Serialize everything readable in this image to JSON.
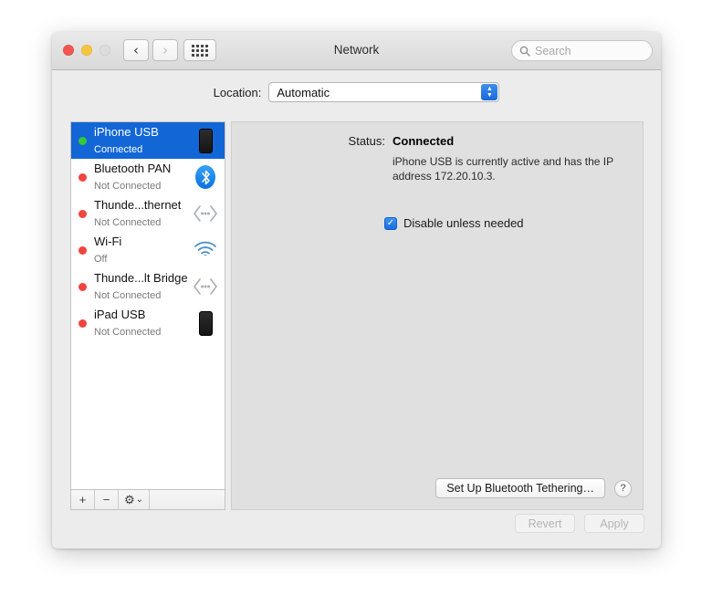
{
  "window": {
    "title": "Network",
    "traffic_lights": [
      "close",
      "minimize",
      "zoom-disabled"
    ],
    "nav_back_icon": "‹",
    "nav_forward_icon": "›",
    "grid_icon": "grid-view-icon"
  },
  "search": {
    "placeholder": "Search",
    "icon": "search-icon"
  },
  "location": {
    "label": "Location:",
    "value": "Automatic",
    "up_arrow": "▲",
    "down_arrow": "▼"
  },
  "sidebar": {
    "items": [
      {
        "name": "iPhone USB",
        "state": "Connected",
        "dot": "green",
        "icon": "iphone-icon",
        "selected": true
      },
      {
        "name": "Bluetooth PAN",
        "state": "Not Connected",
        "dot": "red",
        "icon": "bluetooth-icon",
        "selected": false
      },
      {
        "name": "Thunde...thernet",
        "state": "Not Connected",
        "dot": "red",
        "icon": "thunderbolt-icon",
        "selected": false
      },
      {
        "name": "Wi-Fi",
        "state": "Off",
        "dot": "red",
        "icon": "wifi-icon",
        "selected": false
      },
      {
        "name": "Thunde...lt Bridge",
        "state": "Not Connected",
        "dot": "red",
        "icon": "thunderbolt-icon",
        "selected": false
      },
      {
        "name": "iPad USB",
        "state": "Not Connected",
        "dot": "red",
        "icon": "ipad-icon",
        "selected": false
      }
    ],
    "toolbar": {
      "add_label": "+",
      "remove_label": "−",
      "gear_label": "⚙",
      "gear_chevron": "⌄"
    }
  },
  "main": {
    "status_label": "Status:",
    "status_value": "Connected",
    "status_description": "iPhone USB is currently active and has the IP address 172.20.10.3.",
    "checkbox_label": "Disable unless needed",
    "checkbox_checked": true,
    "checkbox_mark": "✓",
    "tethering_button": "Set Up Bluetooth Tethering…",
    "help_button": "?"
  },
  "footer": {
    "revert_label": "Revert",
    "apply_label": "Apply"
  },
  "colors": {
    "selection_blue": "#1266d6",
    "status_green": "#37c936",
    "status_red": "#f0453c",
    "accent_blue": "#1a6fe0"
  }
}
